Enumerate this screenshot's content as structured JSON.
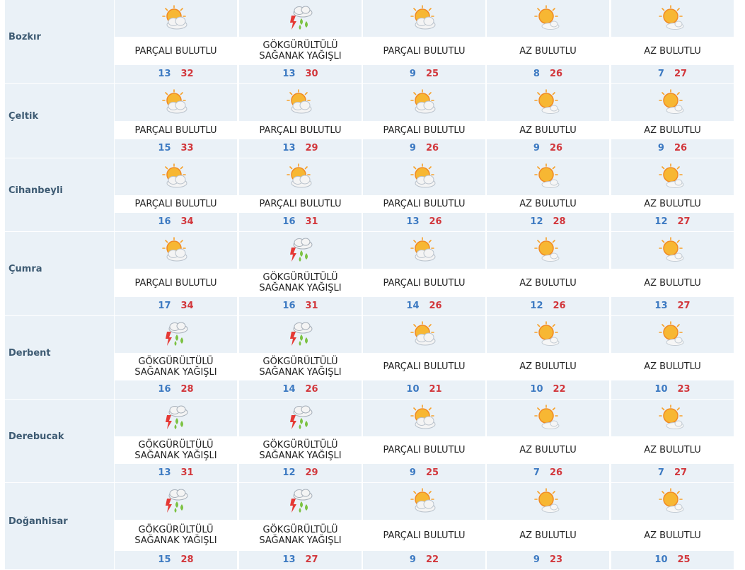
{
  "colors": {
    "low": "#3d7ac2",
    "high": "#d2373c",
    "band": "#eaf1f7",
    "city": "#3e5b73"
  },
  "rows": [
    {
      "city": "Bozkır",
      "days": [
        {
          "icon": "partly-cloudy-icon",
          "condition": "PARÇALI BULUTLU",
          "low": "13",
          "high": "32"
        },
        {
          "icon": "thunderstorm-icon",
          "condition": "GÖKGÜRÜLTÜLÜ SAĞANAK YAĞIŞLI",
          "low": "13",
          "high": "30"
        },
        {
          "icon": "partly-cloudy-icon",
          "condition": "PARÇALI BULUTLU",
          "low": "9",
          "high": "25"
        },
        {
          "icon": "mostly-sunny-icon",
          "condition": "AZ BULUTLU",
          "low": "8",
          "high": "26"
        },
        {
          "icon": "mostly-sunny-icon",
          "condition": "AZ BULUTLU",
          "low": "7",
          "high": "27"
        }
      ]
    },
    {
      "city": "Çeltik",
      "days": [
        {
          "icon": "partly-cloudy-icon",
          "condition": "PARÇALI BULUTLU",
          "low": "15",
          "high": "33"
        },
        {
          "icon": "partly-cloudy-icon",
          "condition": "PARÇALI BULUTLU",
          "low": "13",
          "high": "29"
        },
        {
          "icon": "partly-cloudy-icon",
          "condition": "PARÇALI BULUTLU",
          "low": "9",
          "high": "26"
        },
        {
          "icon": "mostly-sunny-icon",
          "condition": "AZ BULUTLU",
          "low": "9",
          "high": "26"
        },
        {
          "icon": "mostly-sunny-icon",
          "condition": "AZ BULUTLU",
          "low": "9",
          "high": "26"
        }
      ]
    },
    {
      "city": "Cihanbeyli",
      "days": [
        {
          "icon": "partly-cloudy-icon",
          "condition": "PARÇALI BULUTLU",
          "low": "16",
          "high": "34"
        },
        {
          "icon": "partly-cloudy-icon",
          "condition": "PARÇALI BULUTLU",
          "low": "16",
          "high": "31"
        },
        {
          "icon": "partly-cloudy-icon",
          "condition": "PARÇALI BULUTLU",
          "low": "13",
          "high": "26"
        },
        {
          "icon": "mostly-sunny-icon",
          "condition": "AZ BULUTLU",
          "low": "12",
          "high": "28"
        },
        {
          "icon": "mostly-sunny-icon",
          "condition": "AZ BULUTLU",
          "low": "12",
          "high": "27"
        }
      ]
    },
    {
      "city": "Çumra",
      "days": [
        {
          "icon": "partly-cloudy-icon",
          "condition": "PARÇALI BULUTLU",
          "low": "17",
          "high": "34"
        },
        {
          "icon": "thunderstorm-icon",
          "condition": "GÖKGÜRÜLTÜLÜ SAĞANAK YAĞIŞLI",
          "low": "16",
          "high": "31"
        },
        {
          "icon": "partly-cloudy-icon",
          "condition": "PARÇALI BULUTLU",
          "low": "14",
          "high": "26"
        },
        {
          "icon": "mostly-sunny-icon",
          "condition": "AZ BULUTLU",
          "low": "12",
          "high": "26"
        },
        {
          "icon": "mostly-sunny-icon",
          "condition": "AZ BULUTLU",
          "low": "13",
          "high": "27"
        }
      ]
    },
    {
      "city": "Derbent",
      "days": [
        {
          "icon": "thunderstorm-icon",
          "condition": "GÖKGÜRÜLTÜLÜ SAĞANAK YAĞIŞLI",
          "low": "16",
          "high": "28"
        },
        {
          "icon": "thunderstorm-icon",
          "condition": "GÖKGÜRÜLTÜLÜ SAĞANAK YAĞIŞLI",
          "low": "14",
          "high": "26"
        },
        {
          "icon": "partly-cloudy-icon",
          "condition": "PARÇALI BULUTLU",
          "low": "10",
          "high": "21"
        },
        {
          "icon": "mostly-sunny-icon",
          "condition": "AZ BULUTLU",
          "low": "10",
          "high": "22"
        },
        {
          "icon": "mostly-sunny-icon",
          "condition": "AZ BULUTLU",
          "low": "10",
          "high": "23"
        }
      ]
    },
    {
      "city": "Derebucak",
      "days": [
        {
          "icon": "thunderstorm-icon",
          "condition": "GÖKGÜRÜLTÜLÜ SAĞANAK YAĞIŞLI",
          "low": "13",
          "high": "31"
        },
        {
          "icon": "thunderstorm-icon",
          "condition": "GÖKGÜRÜLTÜLÜ SAĞANAK YAĞIŞLI",
          "low": "12",
          "high": "29"
        },
        {
          "icon": "partly-cloudy-icon",
          "condition": "PARÇALI BULUTLU",
          "low": "9",
          "high": "25"
        },
        {
          "icon": "mostly-sunny-icon",
          "condition": "AZ BULUTLU",
          "low": "7",
          "high": "26"
        },
        {
          "icon": "mostly-sunny-icon",
          "condition": "AZ BULUTLU",
          "low": "7",
          "high": "27"
        }
      ]
    },
    {
      "city": "Doğanhisar",
      "days": [
        {
          "icon": "thunderstorm-icon",
          "condition": "GÖKGÜRÜLTÜLÜ SAĞANAK YAĞIŞLI",
          "low": "15",
          "high": "28"
        },
        {
          "icon": "thunderstorm-icon",
          "condition": "GÖKGÜRÜLTÜLÜ SAĞANAK YAĞIŞLI",
          "low": "13",
          "high": "27"
        },
        {
          "icon": "partly-cloudy-icon",
          "condition": "PARÇALI BULUTLU",
          "low": "9",
          "high": "22"
        },
        {
          "icon": "mostly-sunny-icon",
          "condition": "AZ BULUTLU",
          "low": "9",
          "high": "23"
        },
        {
          "icon": "mostly-sunny-icon",
          "condition": "AZ BULUTLU",
          "low": "10",
          "high": "25"
        }
      ]
    }
  ]
}
